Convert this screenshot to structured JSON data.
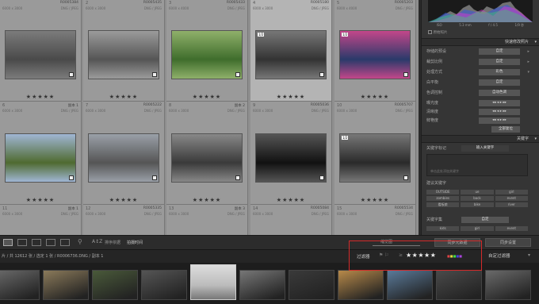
{
  "grid": {
    "row0": [
      {
        "num": "",
        "code": "R0005384",
        "dims": "6000 x 3000",
        "fmt": "DNG / JPEG"
      },
      {
        "num": "2",
        "code": "R0005435",
        "dims": "6000 x 3000",
        "fmt": "DNG / JPEG"
      },
      {
        "num": "3",
        "code": "R0005433",
        "dims": "6000 x 4000",
        "fmt": "DNG / JPEG"
      },
      {
        "num": "4",
        "code": "R0005180",
        "dims": "6000 x 3000",
        "fmt": "DNG / JPEG"
      },
      {
        "num": "5",
        "code": "R0005203",
        "dims": "6000 x 4000",
        "fmt": "DNG / JPEG"
      }
    ],
    "row1": [
      {
        "num": "6",
        "code": "副本 1",
        "dims": "6000 x 3000",
        "fmt": "DNG / JPEG",
        "stars": "★★★★★"
      },
      {
        "num": "7",
        "code": "R0005222",
        "dims": "6000 x 3000",
        "fmt": "DNG / JPEG",
        "stars": "★★★★★"
      },
      {
        "num": "8",
        "code": "副本 2",
        "dims": "6000 x 3000",
        "fmt": "DNG / JPEG",
        "stars": "★★★★★"
      },
      {
        "num": "9",
        "code": "R0005036",
        "dims": "6000 x 3000",
        "fmt": "DNG / JPEG",
        "stars": "★★★★★"
      },
      {
        "num": "10",
        "code": "R0005707",
        "dims": "6000 x 3000",
        "fmt": "DNG / JPEG",
        "stars": "★★★★★"
      }
    ],
    "row2": [
      {
        "num": "11",
        "code": "副本 1",
        "dims": "6000 x 3000",
        "fmt": "DNG / JPEG",
        "stars": "★★★★★"
      },
      {
        "num": "12",
        "code": "R0005335",
        "dims": "6000 x 3000",
        "fmt": "DNG / JPEG",
        "stars": "★★★★★"
      },
      {
        "num": "13",
        "code": "副本 3",
        "dims": "6000 x 3000",
        "fmt": "DNG / JPEG",
        "stars": "★★★★★"
      },
      {
        "num": "14",
        "code": "R0005084",
        "dims": "6000 x 3000",
        "fmt": "DNG / JPEG",
        "stars": "★★★★★"
      },
      {
        "num": "15",
        "code": "R0005534",
        "dims": "6000 x 3000",
        "fmt": "DNG / JPEG",
        "stars": "★★★★★"
      }
    ]
  },
  "histogram": {
    "label": "原始照片",
    "readouts": [
      "ISO",
      "5.3 mm",
      "f / 4.5",
      "1/9 秒"
    ]
  },
  "quick_develop": {
    "header": "快速修改照片",
    "rows": [
      {
        "label": "存储的预设",
        "value": "自定"
      },
      {
        "label": "裁剪比例",
        "value": "自定"
      },
      {
        "label": "处理方式",
        "value": "彩色"
      }
    ],
    "white_balance": "白平衡",
    "tone": "色调控制",
    "wb_value": "自定",
    "auto_tone": "自动色调",
    "exposure": "曝光度",
    "clarity": "清晰度",
    "vibrance": "鲜艳度",
    "reset": "全部复位"
  },
  "keywording": {
    "header": "关键字",
    "tags_label": "关键字标记",
    "tags_value": "输入关键字",
    "placeholder": "单击此处添加关键字",
    "suggestions_label": "建议关键字",
    "suggestions": [
      "OUTSIDE",
      "ue",
      "girl",
      "zombies",
      "back",
      "event",
      "看板娘",
      "bike",
      "river"
    ],
    "set_label": "关键字集",
    "set_value": "自定",
    "extra": [
      "kids",
      "girl",
      "event"
    ]
  },
  "toolbar": {
    "sort_label": "排序依据",
    "sort_value": "拍摄时间",
    "thumb_label": "缩览图",
    "sync_meta": "同步元数据",
    "sync_settings": "同步设置"
  },
  "status": {
    "path": "片 / 共 12612 张 / 选定 1 张 / R0006736.DNG / 副本 1",
    "filter_label": "过滤器",
    "filter_stars": "★★★★★",
    "custom_filter": "自定过滤器"
  },
  "colors": {
    "accent": "#d42a2a",
    "panel": "#353535",
    "grid": "#8f8f8f"
  }
}
